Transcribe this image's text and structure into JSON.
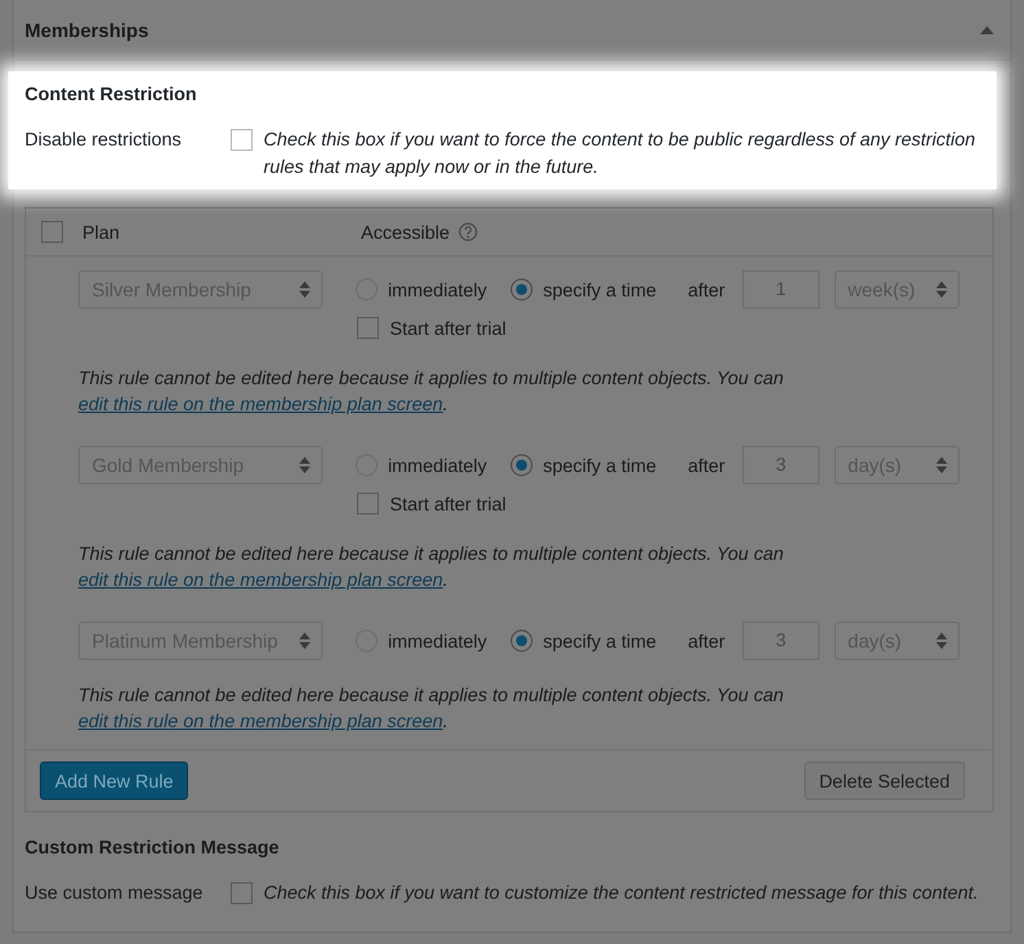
{
  "panel": {
    "title": "Memberships",
    "collapsed": false
  },
  "content_restriction": {
    "heading": "Content Restriction",
    "label": "Disable restrictions",
    "checked": false,
    "description": "Check this box if you want to force the content to be public regardless of any restriction rules that may apply now or in the future."
  },
  "rules_table": {
    "select_all": {
      "checked": false
    },
    "columns": [
      "Plan",
      "Accessible"
    ],
    "rules": [
      {
        "plan": "Silver Membership",
        "options": [
          {
            "label": "immediately",
            "selected": false
          },
          {
            "label": "specify a time",
            "selected": true
          }
        ],
        "after_label": "after",
        "amount": "1",
        "unit": "week(s)",
        "start_after_trial": {
          "label": "Start after trial",
          "checked": false
        },
        "note": "This rule cannot be edited here because it applies to multiple content objects. You can ",
        "note_link": "edit this rule on the membership plan screen",
        "note_end": "."
      },
      {
        "plan": "Gold Membership",
        "options": [
          {
            "label": "immediately",
            "selected": false
          },
          {
            "label": "specify a time",
            "selected": true
          }
        ],
        "after_label": "after",
        "amount": "3",
        "unit": "day(s)",
        "start_after_trial": {
          "label": "Start after trial",
          "checked": false
        },
        "note": "This rule cannot be edited here because it applies to multiple content objects. You can ",
        "note_link": "edit this rule on the membership plan screen",
        "note_end": "."
      },
      {
        "plan": "Platinum Membership",
        "options": [
          {
            "label": "immediately",
            "selected": false
          },
          {
            "label": "specify a time",
            "selected": true
          }
        ],
        "after_label": "after",
        "amount": "3",
        "unit": "day(s)",
        "note": "This rule cannot be edited here because it applies to multiple content objects. You can ",
        "note_link": "edit this rule on the membership plan screen",
        "note_end": "."
      }
    ],
    "buttons": [
      {
        "kind": "primary",
        "label": "Add New Rule"
      },
      {
        "kind": "secondary",
        "label": "Delete Selected"
      }
    ]
  },
  "custom_message": {
    "heading": "Custom Restriction Message",
    "label": "Use custom message",
    "checked": false,
    "description": "Check this box if you want to customize the content restricted message for this content."
  }
}
